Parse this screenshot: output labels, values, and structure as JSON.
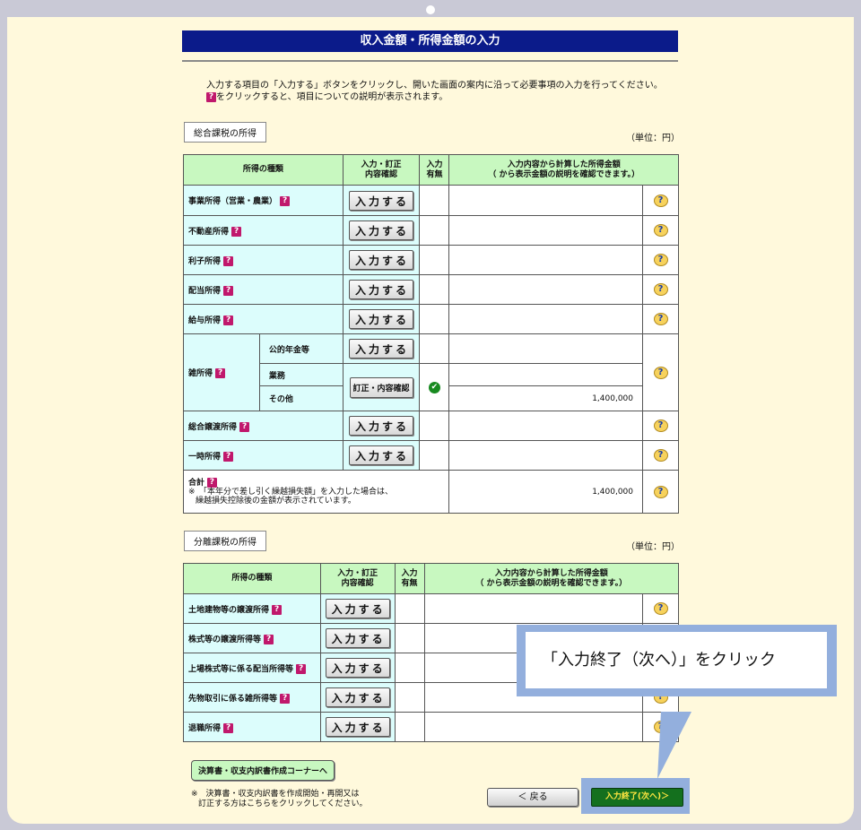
{
  "title": "収入金額・所得金額の入力",
  "instructions": {
    "line1": "入力する項目の「入力する」ボタンをクリックし、開いた画面の案内に沿って必要事項の入力を行ってください。",
    "line2": "をクリックすると、項目についての説明が表示されます。"
  },
  "help_icon_glyph": "?",
  "section1": {
    "label": "総合課税の所得",
    "unit": "（単位：円）",
    "headers": {
      "type": "所得の種類",
      "entry": "入力・訂正\n内容確認",
      "has_input": "入力\n有無",
      "amount": "入力内容から計算した所得金額\n（ から表示金額の説明を確認できます。）"
    },
    "rows": [
      {
        "label": "事業所得（営業・農業）",
        "button": "入力する"
      },
      {
        "label": "不動産所得",
        "button": "入力する"
      },
      {
        "label": "利子所得",
        "button": "入力する"
      },
      {
        "label": "配当所得",
        "button": "入力する"
      },
      {
        "label": "給与所得",
        "button": "入力する"
      }
    ],
    "misc": {
      "label": "雑所得",
      "sub1": "公的年金等",
      "sub1_button": "入力する",
      "sub2": "業務",
      "sub3": "その他",
      "sub23_button": "訂正・内容確認",
      "sub3_value": "1,400,000"
    },
    "rows2": [
      {
        "label": "総合譲渡所得",
        "button": "入力する"
      },
      {
        "label": "一時所得",
        "button": "入力する"
      }
    ],
    "total": {
      "label": "合計",
      "note1": "※　「本年分で差し引く繰越損失額」を入力した場合は、",
      "note2": "繰越損失控除後の金額が表示されています。",
      "value": "1,400,000"
    }
  },
  "section2": {
    "label": "分離課税の所得",
    "unit": "（単位：円）",
    "headers": {
      "type": "所得の種類",
      "entry": "入力・訂正\n内容確認",
      "has_input": "入力\n有無",
      "amount": "入力内容から計算した所得金額\n（ から表示金額の説明を確認できます。）"
    },
    "rows": [
      {
        "label": "土地建物等の譲渡所得",
        "button": "入力する"
      },
      {
        "label": "株式等の譲渡所得等",
        "button": "入力する"
      },
      {
        "label": "上場株式等に係る配当所得等",
        "button": "入力する"
      },
      {
        "label": "先物取引に係る雑所得等",
        "button": "入力する"
      },
      {
        "label": "退職所得",
        "button": "入力する"
      }
    ]
  },
  "footer": {
    "corner_button": "決算書・収支内訳書作成コーナーへ",
    "note1": "※　決算書・収支内訳書を作成開始・再開又は",
    "note2": "訂正する方はこちらをクリックしてください。",
    "back_button": "＜ 戻る",
    "next_button": "入力終了(次へ)＞"
  },
  "callout": "「入力終了（次へ）」をクリック",
  "colors": {
    "title_bar": "#0b1b8a",
    "header_green": "#c8f8c0",
    "label_cyan": "#dcfdfc",
    "page_bg": "#fff9dc",
    "callout_blue": "#93afdd",
    "next_button": "#14701e"
  }
}
